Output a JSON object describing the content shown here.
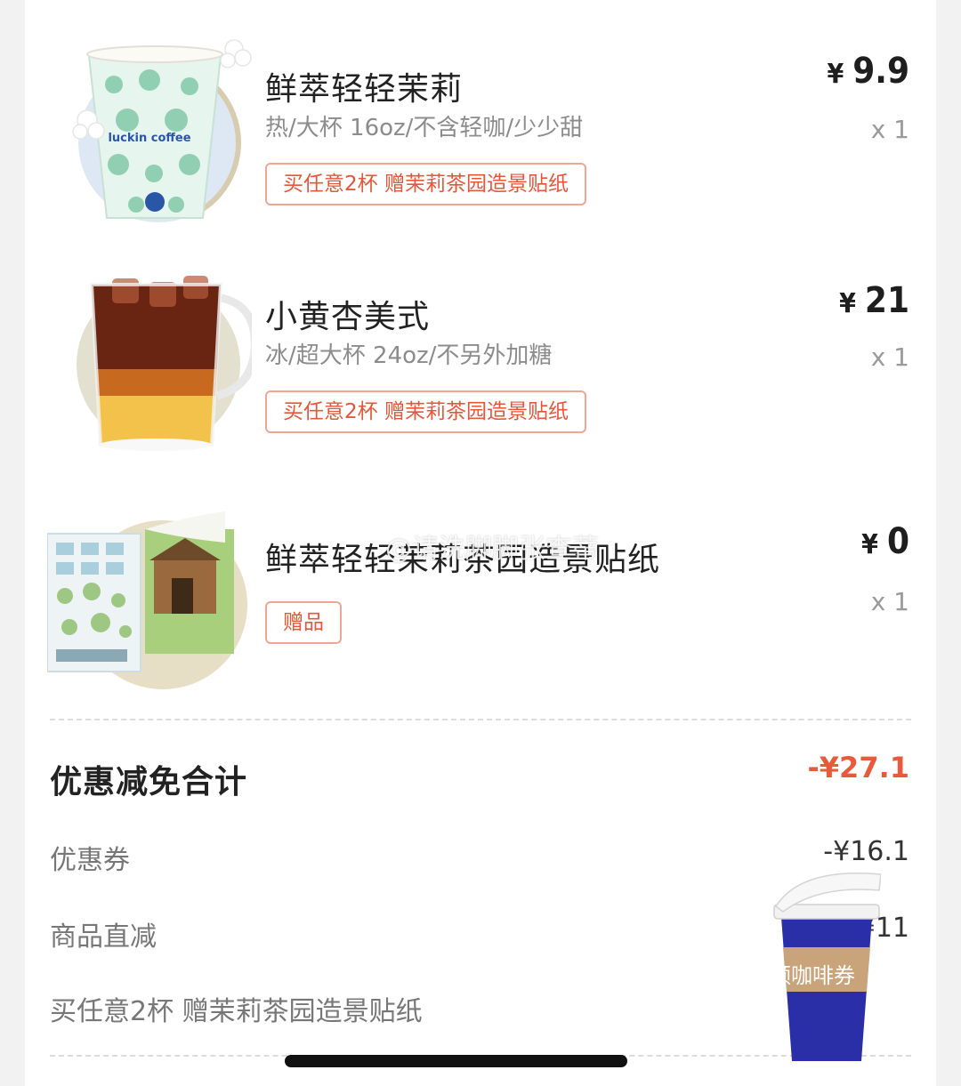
{
  "items": [
    {
      "name": "鲜萃轻轻茉莉",
      "spec": "热/大杯 16oz/不含轻咖/少少甜",
      "tag": "买任意2杯 赠茉莉茶园造景贴纸",
      "currency": "¥",
      "price": "9.9",
      "qty": "x 1",
      "image_icon": "luckin-jasmine-cup-image",
      "cup_brand": "luckin coffee"
    },
    {
      "name": "小黄杏美式",
      "spec": "冰/超大杯 24oz/不另外加糖",
      "tag": "买任意2杯 赠茉莉茶园造景贴纸",
      "currency": "¥",
      "price": "21",
      "qty": "x 1",
      "image_icon": "iced-apricot-americano-image"
    },
    {
      "name": "鲜萃轻轻茉莉茶园造景贴纸",
      "tag": "赠品",
      "currency": "¥",
      "price": "0",
      "qty": "x 1",
      "image_icon": "sticker-sheet-image"
    }
  ],
  "summary": {
    "title": "优惠减免合计",
    "total": "-¥27.1",
    "rows": [
      {
        "label": "优惠券",
        "value": "-¥16.1"
      },
      {
        "label": "商品直减",
        "value": "-¥11"
      },
      {
        "label": "买任意2杯 赠茉莉茶园造景贴纸",
        "value": ""
      }
    ]
  },
  "floating_coupon": {
    "label": "领咖啡券",
    "icon": "coffee-cup-icon"
  },
  "watermark": "@请洗脚脚张查蒂",
  "colors": {
    "accent": "#e85a3a",
    "tag_border": "#f0a595",
    "coupon_blue": "#2a2fa8",
    "coupon_band": "#c9a47a"
  }
}
